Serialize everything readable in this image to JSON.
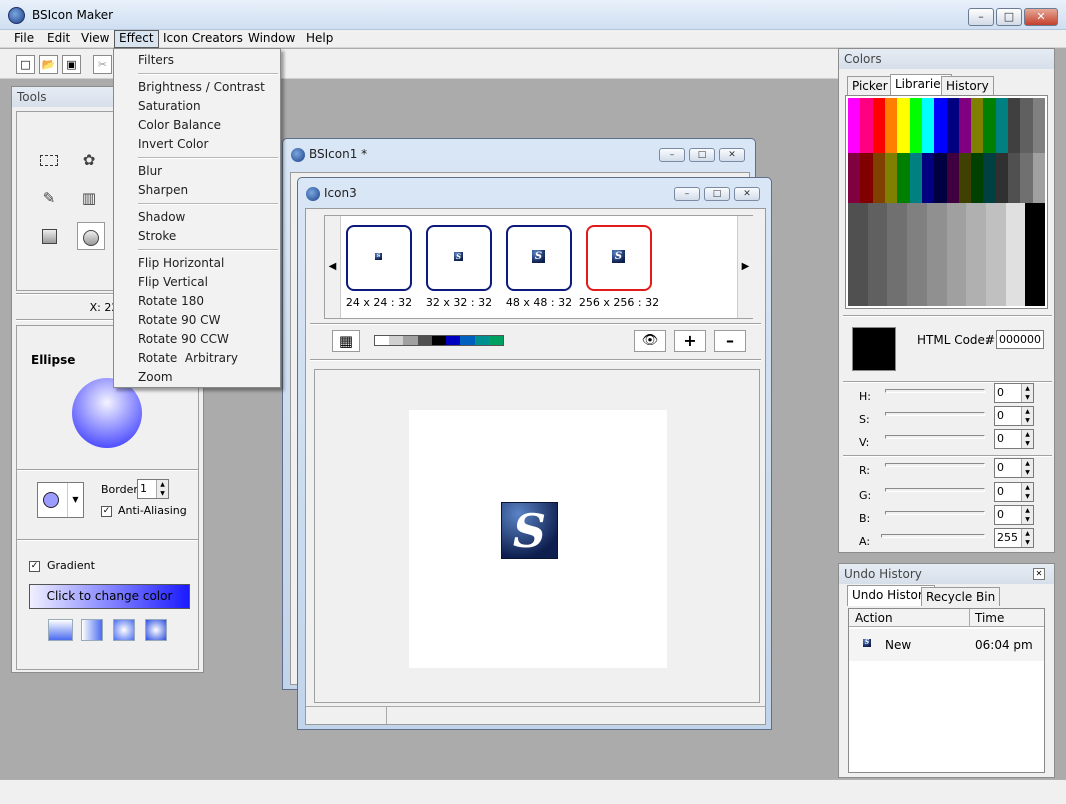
{
  "app": {
    "title": "BSIcon Maker",
    "caption_buttons": [
      "–",
      "□",
      "✕"
    ]
  },
  "menubar": [
    "File",
    "Edit",
    "View",
    "Effect",
    "Icon Creators",
    "Window",
    "Help"
  ],
  "effect_menu": {
    "groups": [
      [
        "Filters"
      ],
      [
        "Brightness / Contrast",
        "Saturation",
        "Color Balance",
        "Invert Color"
      ],
      [
        "Blur",
        "Sharpen"
      ],
      [
        "Shadow",
        "Stroke"
      ],
      [
        "Flip Horizontal",
        "Flip Vertical",
        "Rotate 180",
        "Rotate 90 CW",
        "Rotate 90 CCW",
        "Rotate  Arbitrary",
        "Zoom"
      ]
    ]
  },
  "tools": {
    "caption": "Tools",
    "coord": "X: 220",
    "shape_name": "Ellipse",
    "border_label": "Border:",
    "border_value": "1",
    "anti_aliasing_label": "Anti-Aliasing",
    "anti_aliasing_checked": true,
    "gradient_label": "Gradient",
    "gradient_checked": true,
    "gradient_button": "Click to change color"
  },
  "windows": {
    "back": {
      "title": "BSIcon1 *"
    },
    "front": {
      "title": "Icon3",
      "thumbnails": [
        {
          "label": "24 x 24 : 32",
          "selected": false
        },
        {
          "label": "32 x 32 : 32",
          "selected": false
        },
        {
          "label": "48 x 48 : 32",
          "selected": false
        },
        {
          "label": "256 x 256 : 32",
          "selected": true
        }
      ],
      "icon_glyph": "S"
    }
  },
  "colors": {
    "caption": "Colors",
    "tabs": [
      "Picker",
      "Libraries",
      "History"
    ],
    "active_tab": "Libraries",
    "html_code_label": "HTML Code:",
    "hash": "#",
    "html_code_value": "000000",
    "current_color": "#000000",
    "hsv": [
      {
        "label": "H:",
        "value": "0"
      },
      {
        "label": "S:",
        "value": "0"
      },
      {
        "label": "V:",
        "value": "0"
      }
    ],
    "rgba": [
      {
        "label": "R:",
        "value": "0"
      },
      {
        "label": "G:",
        "value": "0"
      },
      {
        "label": "B:",
        "value": "0"
      },
      {
        "label": "A:",
        "value": "255"
      }
    ],
    "palette_top": [
      "#ff00ff",
      "#ff0080",
      "#ff0000",
      "#ff8000",
      "#ffff00",
      "#00ff00",
      "#00ffff",
      "#0000ff",
      "#000080",
      "#800080",
      "#808000",
      "#008000",
      "#008080",
      "#404040",
      "#606060",
      "#808080"
    ],
    "palette_top_dark": [
      "#800040",
      "#800000",
      "#804000",
      "#808000",
      "#008000",
      "#008080",
      "#000080",
      "#000040",
      "#400040",
      "#404000",
      "#004000",
      "#004040",
      "#303030",
      "#505050",
      "#707070",
      "#a0a0a0"
    ],
    "palette_bottom": [
      "#505050",
      "#606060",
      "#707070",
      "#808080",
      "#909090",
      "#a0a0a0",
      "#b0b0b0",
      "#c0c0c0",
      "#e0e0e0",
      "#000000"
    ]
  },
  "undo": {
    "caption": "Undo History",
    "tabs": [
      "Undo History",
      "Recycle Bin"
    ],
    "columns": [
      "Action",
      "Time"
    ],
    "rows": [
      {
        "action": "New",
        "time": "06:04 pm"
      }
    ]
  },
  "mini_palette": [
    "#ffffff",
    "#d0d0d0",
    "#a0a0a0",
    "#505050",
    "#000000",
    "#0000c0",
    "#0060c0",
    "#009090",
    "#00a060"
  ]
}
